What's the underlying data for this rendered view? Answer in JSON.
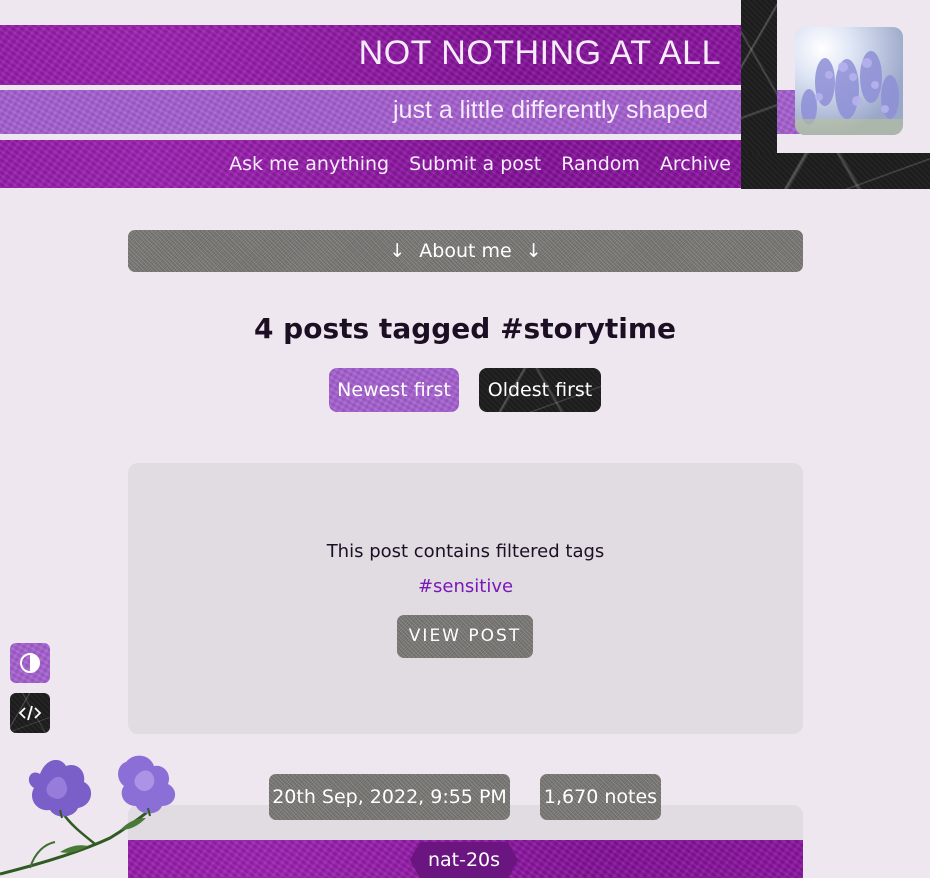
{
  "header": {
    "title": "NOT NOTHING AT ALL",
    "subtitle": "just a little differently shaped",
    "nav": [
      {
        "label": "Ask me anything"
      },
      {
        "label": "Submit a post"
      },
      {
        "label": "Random"
      },
      {
        "label": "Archive"
      }
    ]
  },
  "about": {
    "label": "About me",
    "arrow": "↓"
  },
  "tag_page": {
    "heading": "4 posts tagged #storytime",
    "sort": {
      "newest": "Newest first",
      "oldest": "Oldest first"
    }
  },
  "post": {
    "filter_message": "This post contains filtered tags",
    "filtered_tag": "#sensitive",
    "view_button": "VIEW POST"
  },
  "next_post": {
    "date": "20th Sep, 2022, 9:55 PM",
    "notes": "1,670 notes",
    "author": "nat-20s"
  },
  "side_controls": {
    "contrast_icon": "contrast-icon",
    "code_icon": "code-icon"
  },
  "colors": {
    "background": "#efe7ef",
    "header_purple": "#8e16a3",
    "accent_lilac": "#a45fd0",
    "marble_dark": "#1d1d1d",
    "granite_gray": "#7b7a76",
    "tag_link": "#7b18b8"
  }
}
